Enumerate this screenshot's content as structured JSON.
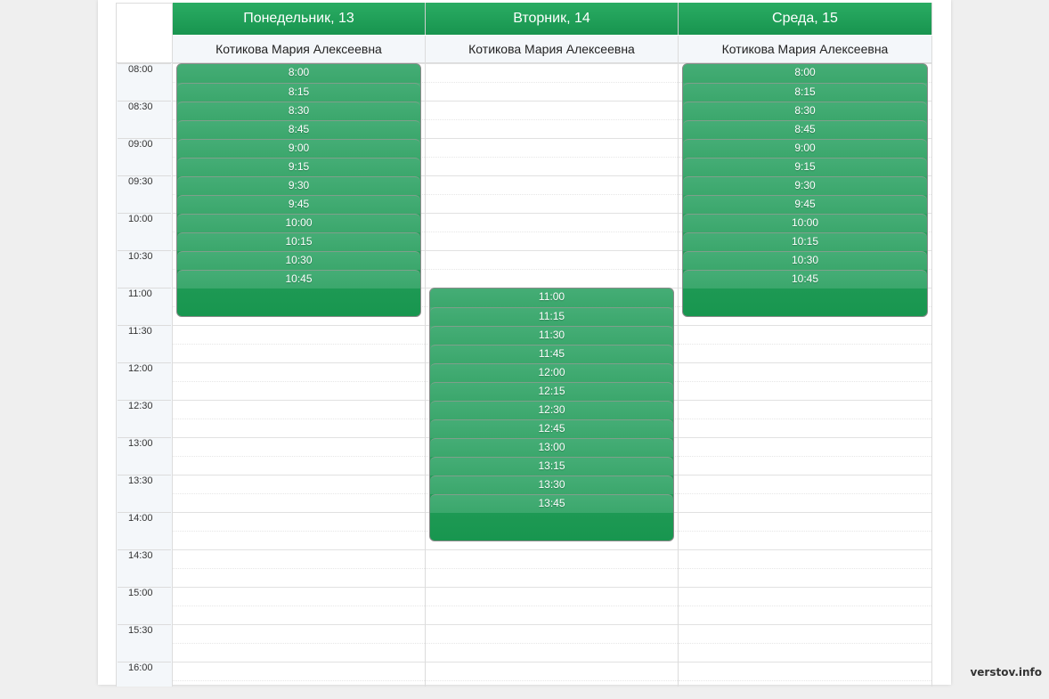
{
  "days": [
    {
      "header": "Понедельник, 13",
      "person": "Котикова Мария Алексеевна",
      "slots": [
        "8:00",
        "8:15",
        "8:30",
        "8:45",
        "9:00",
        "9:15",
        "9:30",
        "9:45",
        "10:00",
        "10:15",
        "10:30",
        "10:45"
      ]
    },
    {
      "header": "Вторник, 14",
      "person": "Котикова Мария Алексеевна",
      "slots": [
        "11:00",
        "11:15",
        "11:30",
        "11:45",
        "12:00",
        "12:15",
        "12:30",
        "12:45",
        "13:00",
        "13:15",
        "13:30",
        "13:45"
      ]
    },
    {
      "header": "Среда, 15",
      "person": "Котикова Мария Алексеевна",
      "slots": [
        "8:00",
        "8:15",
        "8:30",
        "8:45",
        "9:00",
        "9:15",
        "9:30",
        "9:45",
        "10:00",
        "10:15",
        "10:30",
        "10:45"
      ]
    }
  ],
  "times": [
    "08:00",
    "08:30",
    "09:00",
    "09:30",
    "10:00",
    "10:30",
    "11:00",
    "11:30",
    "12:00",
    "12:30",
    "13:00",
    "13:30",
    "14:00",
    "14:30",
    "15:00",
    "15:30",
    "16:00"
  ],
  "watermark": "verstov.info",
  "colors": {
    "header_green": "#1f9e57",
    "slot_green": "#3ba76c"
  }
}
